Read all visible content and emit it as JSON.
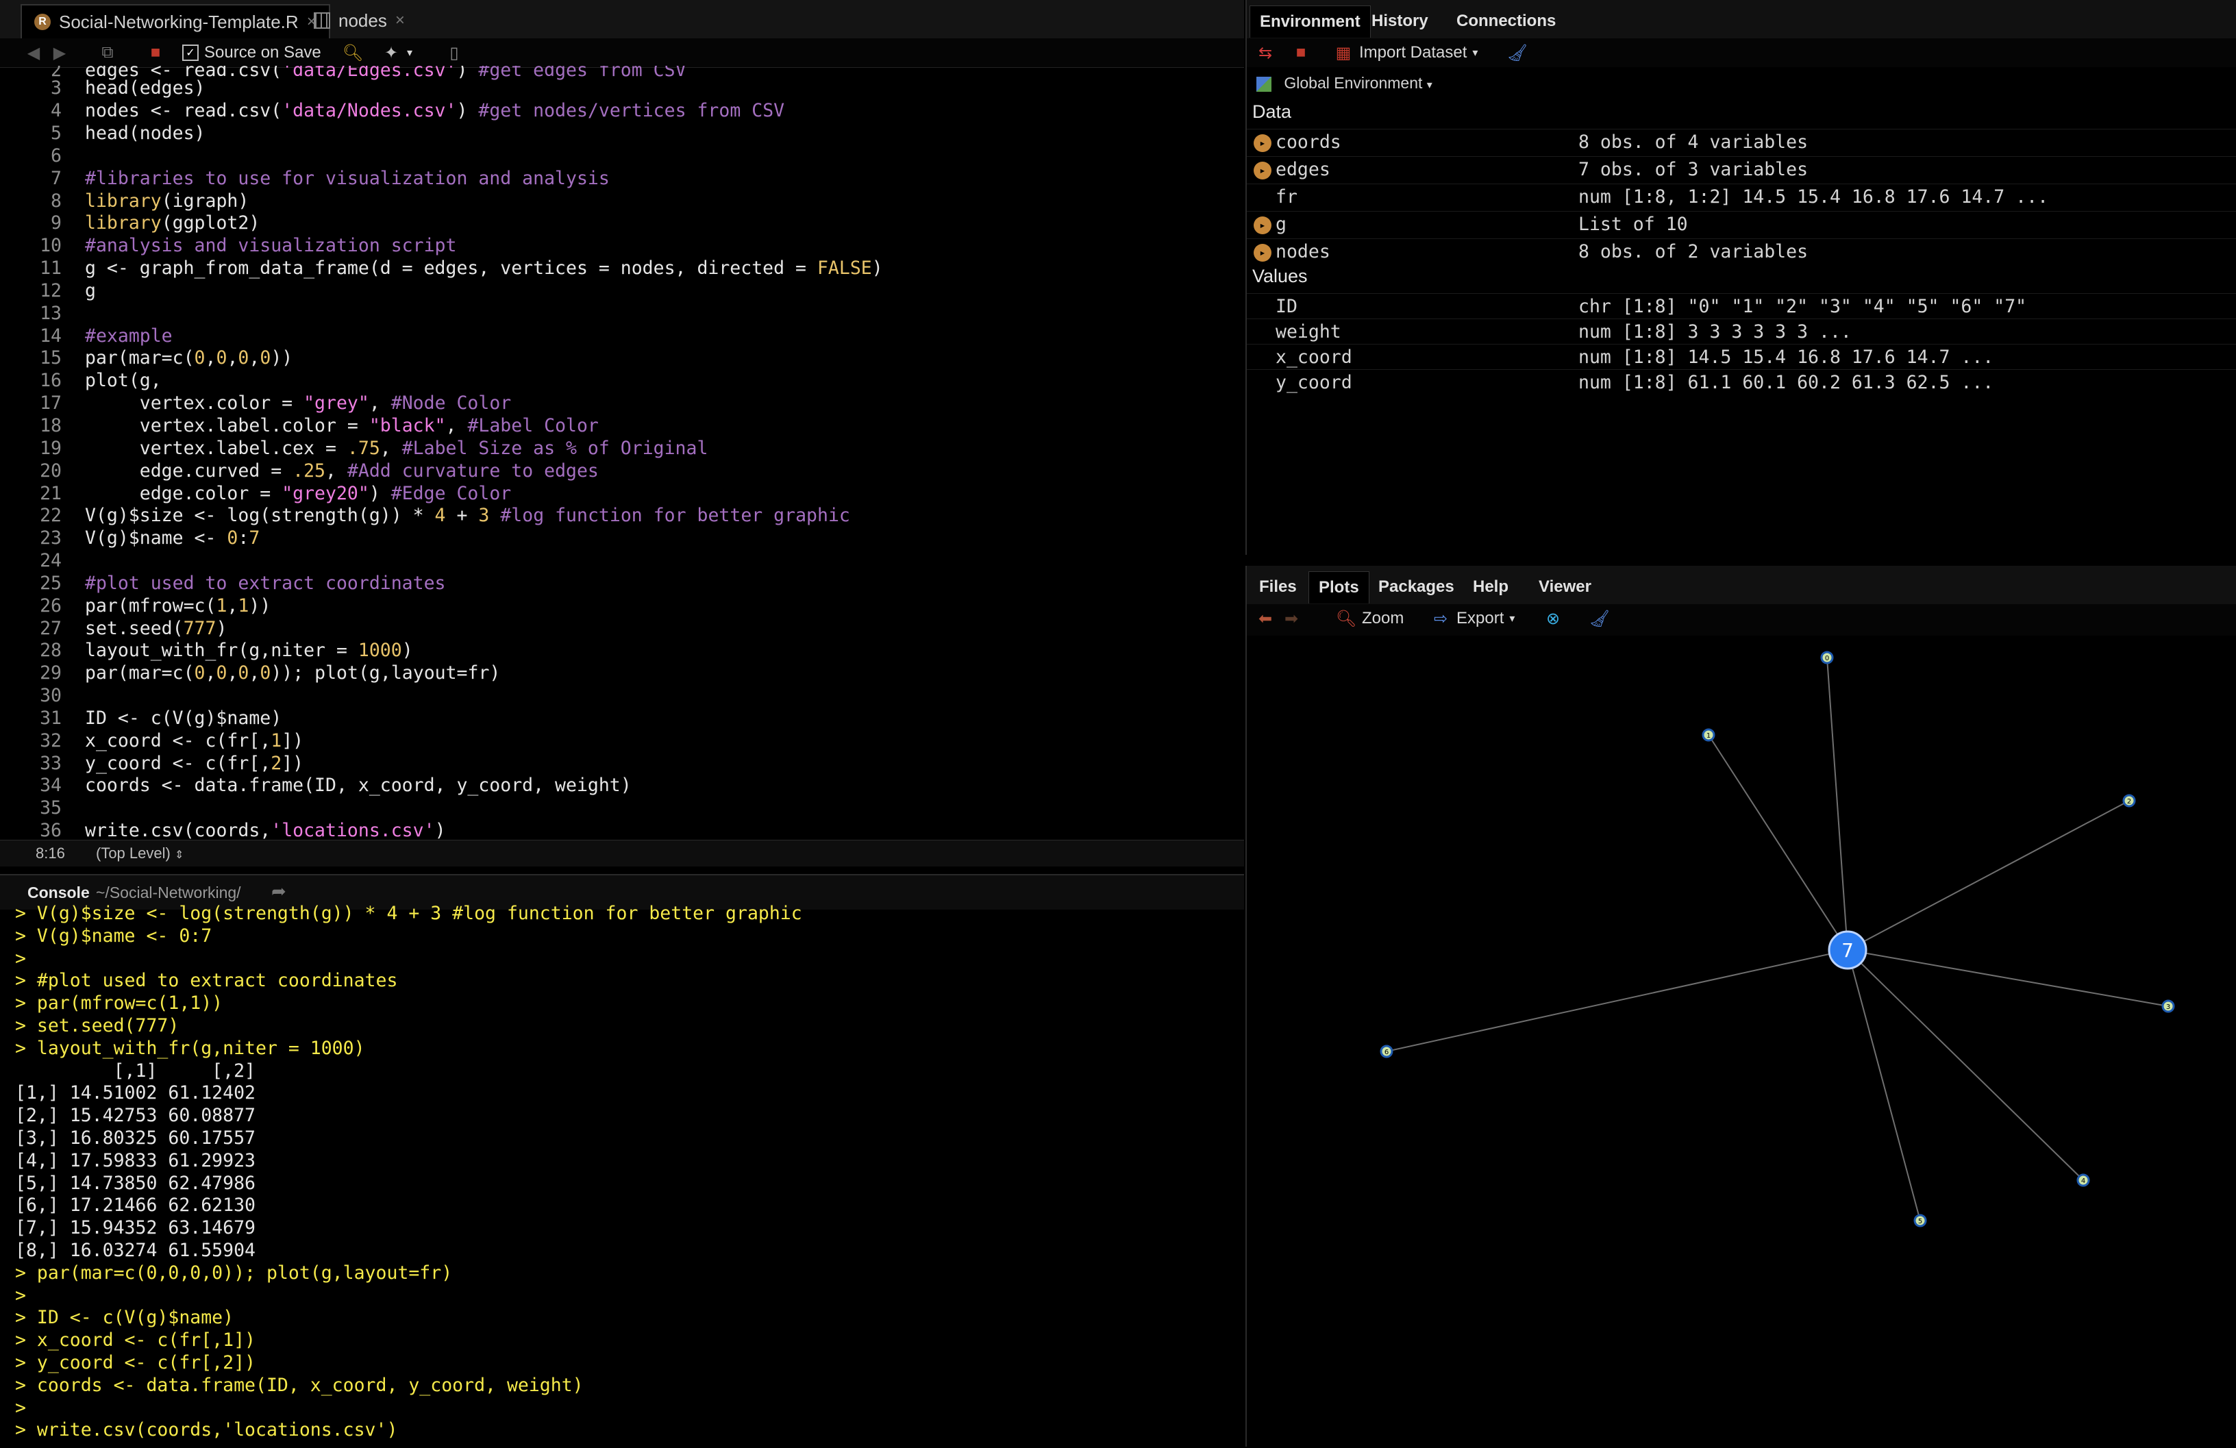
{
  "editor": {
    "tabs": [
      {
        "label": "Social-Networking-Template.R"
      },
      {
        "label": "nodes"
      }
    ],
    "toolbar": {
      "source_on_save": "Source on Save"
    },
    "status": {
      "position": "8:16",
      "scope": "(Top Level)"
    }
  },
  "console": {
    "title": "Console",
    "path": "~/Social-Networking/",
    "lines": [
      "> V(g)$size <- log(strength(g)) * 4 + 3 #log function for better graphic",
      "> V(g)$name <- 0:7",
      ">",
      "> #plot used to extract coordinates",
      "> par(mfrow=c(1,1))",
      "> set.seed(777)",
      "> layout_with_fr(g,niter = 1000)",
      "         [,1]     [,2]",
      "[1,] 14.51002 61.12402",
      "[2,] 15.42753 60.08877",
      "[3,] 16.80325 60.17557",
      "[4,] 17.59833 61.29923",
      "[5,] 14.73850 62.47986",
      "[6,] 17.21466 62.62130",
      "[7,] 15.94352 63.14679",
      "[8,] 16.03274 61.55904",
      "> par(mar=c(0,0,0,0)); plot(g,layout=fr)",
      ">",
      "> ID <- c(V(g)$name)",
      "> x_coord <- c(fr[,1])",
      "> y_coord <- c(fr[,2])",
      "> coords <- data.frame(ID, x_coord, y_coord, weight)",
      ">",
      "> write.csv(coords,'locations.csv')"
    ]
  },
  "environment": {
    "tabs": [
      "Environment",
      "History",
      "Connections"
    ],
    "import_dataset": "Import Dataset",
    "scope": "Global Environment",
    "data_header": "Data",
    "values_header": "Values",
    "data": [
      {
        "name": "coords",
        "value": "8 obs. of 4 variables",
        "expandable": true
      },
      {
        "name": "edges",
        "value": "7 obs. of 3 variables",
        "expandable": true
      },
      {
        "name": "fr",
        "value": "num [1:8, 1:2] 14.5 15.4 16.8 17.6 14.7 ...",
        "expandable": false
      },
      {
        "name": "g",
        "value": "List of 10",
        "expandable": true
      },
      {
        "name": "nodes",
        "value": "8 obs. of 2 variables",
        "expandable": true
      }
    ],
    "values": [
      {
        "name": "ID",
        "value": "chr [1:8] \"0\" \"1\" \"2\" \"3\" \"4\" \"5\" \"6\" \"7\""
      },
      {
        "name": "weight",
        "value": "num [1:8] 3 3 3 3 3 3 ..."
      },
      {
        "name": "x_coord",
        "value": "num [1:8] 14.5 15.4 16.8 17.6 14.7 ..."
      },
      {
        "name": "y_coord",
        "value": "num [1:8] 61.1 60.1 60.2 61.3 62.5 ..."
      }
    ]
  },
  "plots": {
    "tabs": [
      "Files",
      "Plots",
      "Packages",
      "Help",
      "Viewer"
    ],
    "zoom": "Zoom",
    "export": "Export",
    "hub_label": "7",
    "leaf_labels": [
      "0",
      "1",
      "2",
      "3",
      "4",
      "5",
      "6"
    ]
  },
  "colors": {
    "comment": "#a46fc0",
    "string": "#ee7ee0",
    "number": "#e9c46a",
    "console_input": "#f5e94a",
    "hub_node": "#2a7bf0",
    "edge": "#6f6f6f"
  }
}
